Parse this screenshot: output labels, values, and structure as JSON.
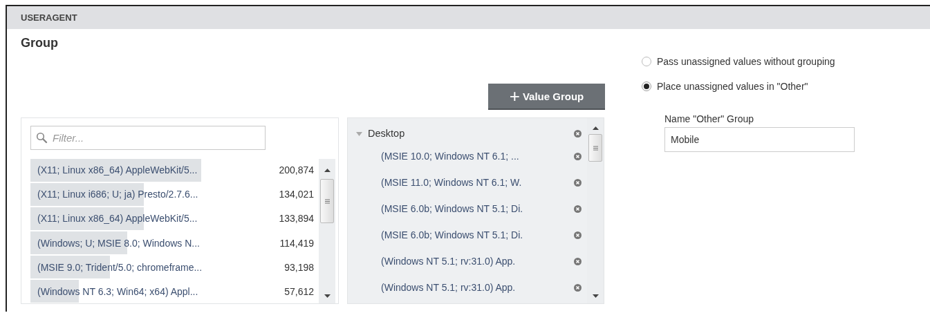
{
  "header": {
    "title": "USERAGENT"
  },
  "section": {
    "title": "Group"
  },
  "add_button": {
    "icon": "+",
    "label": "Value Group"
  },
  "values_list": {
    "filter": {
      "placeholder": "Filter..."
    },
    "rows": [
      {
        "label": "(X11; Linux x86_64) AppleWebKit/5...",
        "count": "200,874",
        "level": 0.6
      },
      {
        "label": "(X11; Linux i686; U; ja) Presto/2.7.6...",
        "count": "134,021",
        "level": 0.4
      },
      {
        "label": "(X11; Linux x86_64) AppleWebKit/5...",
        "count": "133,894",
        "level": 0.4
      },
      {
        "label": "(Windows; U; MSIE 8.0; Windows N...",
        "count": "114,419",
        "level": 0.34
      },
      {
        "label": "(MSIE 9.0; Trident/5.0; chromeframe...",
        "count": "93,198",
        "level": 0.28
      },
      {
        "label": "(Windows NT 6.3; Win64; x64) Appl...",
        "count": "57,612",
        "level": 0.17
      }
    ]
  },
  "groups_tree": {
    "groups": [
      {
        "name": "Desktop",
        "expanded": true,
        "children": [
          {
            "label": "(MSIE 10.0; Windows NT 6.1; ..."
          },
          {
            "label": "(MSIE 11.0; Windows NT 6.1; W."
          },
          {
            "label": "(MSIE 6.0b; Windows NT 5.1; Di."
          },
          {
            "label": "(MSIE 6.0b; Windows NT 5.1; Di."
          },
          {
            "label": "(Windows NT 5.1; rv:31.0) App."
          },
          {
            "label": "(Windows NT 5.1; rv:31.0) App."
          }
        ]
      }
    ]
  },
  "options": [
    {
      "label": "Pass unassigned values without grouping",
      "selected": false
    },
    {
      "label": "Place unassigned values in \"Other\"",
      "selected": true
    }
  ],
  "other_group": {
    "label": "Name \"Other\" Group",
    "value": "Mobile"
  }
}
